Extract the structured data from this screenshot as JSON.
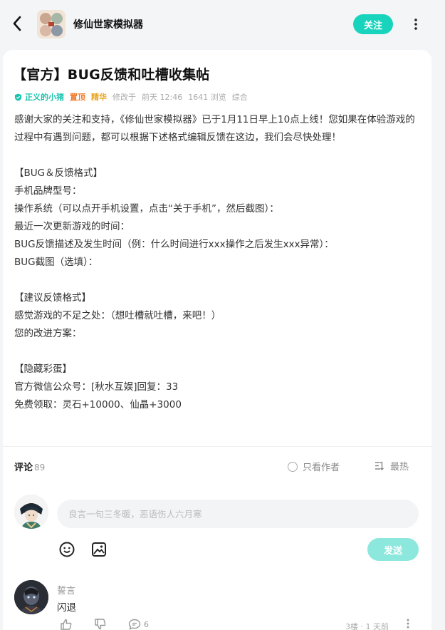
{
  "header": {
    "game_name": "修仙世家模拟器",
    "follow_label": "关注"
  },
  "post": {
    "title": "【官方】BUG反馈和吐槽收集帖",
    "author": "正义的小猪",
    "tag_top": "置顶",
    "tag_essence": "精华",
    "modified_label": "修改于",
    "modified_time": "前天 12:46",
    "views": "1641 浏览",
    "category": "综合",
    "content": [
      "感谢大家的关注和支持，《修仙世家模拟器》已于1月11日早上10点上线！您如果在体验游戏的过程中有遇到问题，都可以根据下述格式编辑反馈在这边，我们会尽快处理！",
      "",
      "【BUG＆反馈格式】",
      "手机品牌型号：",
      "操作系统（可以点开手机设置，点击“关于手机”，然后截图）：",
      "最近一次更新游戏的时间：",
      "BUG反馈描述及发生时间（例：什么时间进行xxx操作之后发生xxx异常）：",
      "BUG截图（选填）：",
      "",
      "【建议反馈格式】",
      "感觉游戏的不足之处：（想吐槽就吐槽，来吧！）",
      "您的改进方案：",
      "",
      "【隐藏彩蛋】",
      "官方微信公众号：[秋水互娱]回复：33",
      "免费领取：灵石+10000、仙晶+3000"
    ]
  },
  "comments": {
    "label": "评论",
    "count": "89",
    "author_only_label": "只看作者",
    "sort_label": "最热",
    "input_placeholder": "良言一句三冬暖，恶语伤人六月寒",
    "send_label": "发送",
    "items": [
      {
        "user": "誓言",
        "text": "闪退",
        "reply_count": "6",
        "floor": "3楼 · 1 天前"
      }
    ]
  },
  "colors": {
    "accent": "#19d4bd",
    "author": "#19c3ad",
    "top_tag": "#f07a2a",
    "essence_tag": "#e9a422"
  }
}
